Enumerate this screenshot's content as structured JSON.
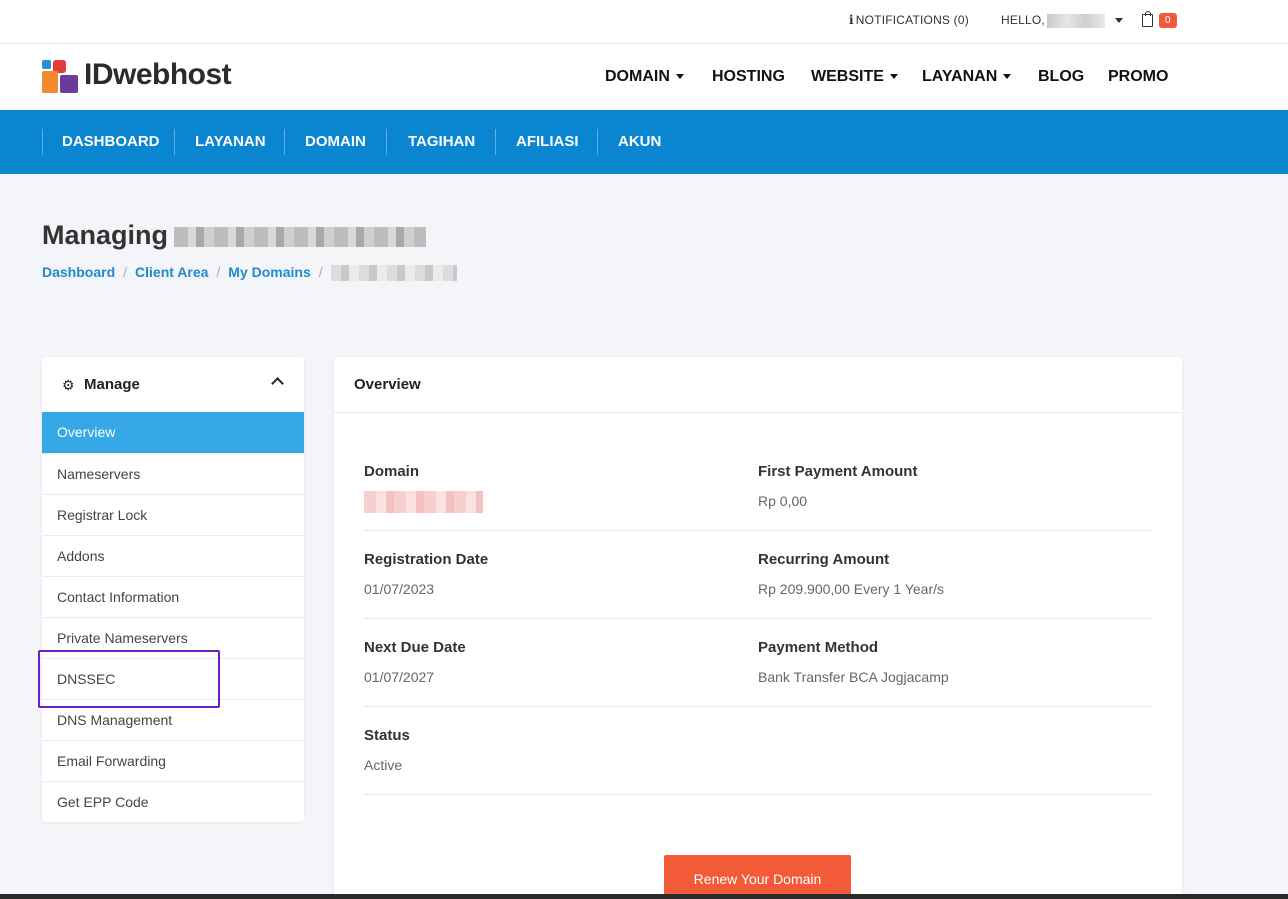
{
  "topbar": {
    "notifications_label": "NOTIFICATIONS (0)",
    "hello_label": "HELLO,",
    "cart_count": "0"
  },
  "header": {
    "brand": "IDwebhost",
    "nav": [
      "DOMAIN",
      "HOSTING",
      "WEBSITE",
      "LAYANAN",
      "BLOG",
      "PROMO"
    ]
  },
  "subnav": [
    "DASHBOARD",
    "LAYANAN",
    "DOMAIN",
    "TAGIHAN",
    "AFILIASI",
    "AKUN"
  ],
  "page": {
    "title_prefix": "Managing",
    "breadcrumbs": [
      "Dashboard",
      "Client Area",
      "My Domains"
    ]
  },
  "sidebar": {
    "title": "Manage",
    "items": [
      "Overview",
      "Nameservers",
      "Registrar Lock",
      "Addons",
      "Contact Information",
      "Private Nameservers",
      "DNSSEC",
      "DNS Management",
      "Email Forwarding",
      "Get EPP Code"
    ]
  },
  "overview": {
    "title": "Overview",
    "domain_label": "Domain",
    "first_payment_label": "First Payment Amount",
    "first_payment_value": "Rp 0,00",
    "registration_label": "Registration Date",
    "registration_value": "01/07/2023",
    "recurring_label": "Recurring Amount",
    "recurring_value": "Rp 209.900,00 Every 1 Year/s",
    "next_due_label": "Next Due Date",
    "next_due_value": "01/07/2027",
    "payment_method_label": "Payment Method",
    "payment_method_value": "Bank Transfer BCA Jogjacamp",
    "status_label": "Status",
    "status_value": "Active",
    "renew_button": "Renew Your Domain"
  },
  "colors": {
    "primary_blue": "#0a86d0",
    "active_item": "#37a8e6",
    "accent_orange": "#f35a37",
    "highlight_purple": "#6a1fc9"
  }
}
